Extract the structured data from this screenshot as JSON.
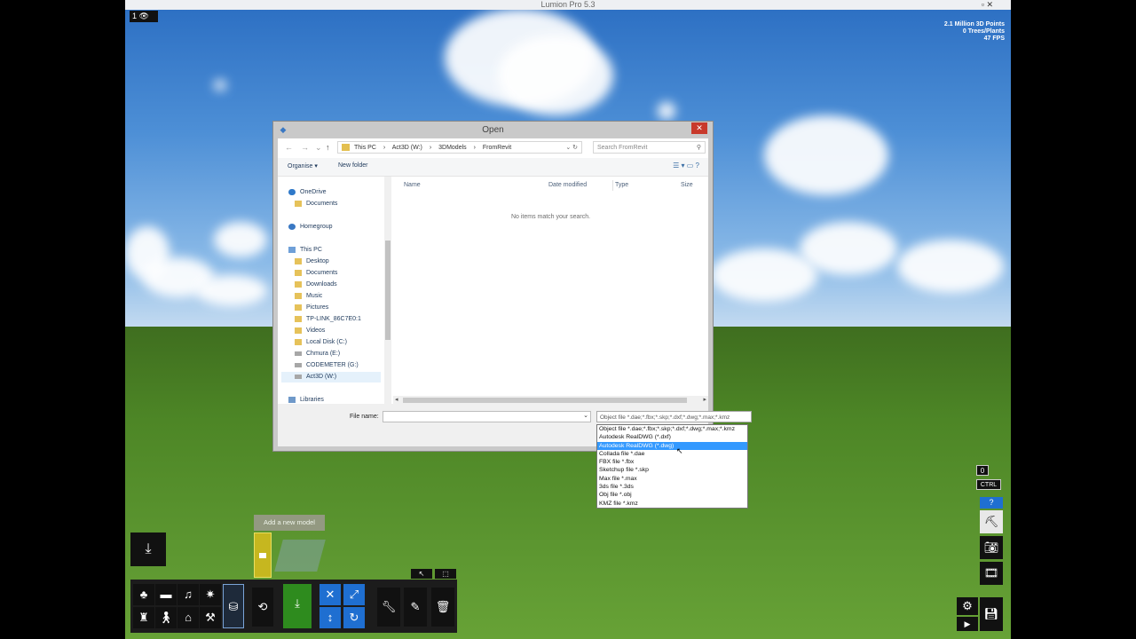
{
  "app": {
    "title": "Lumion Pro 5.3",
    "minimize_glyph": "▫  ✕"
  },
  "viewport": {
    "badge": "1 👁",
    "stats": [
      "2.1 Million 3D Points",
      "0 Trees/Plants",
      "47 FPS"
    ]
  },
  "dialog": {
    "title": "Open",
    "close_glyph": "✕",
    "nav_buttons": [
      "←",
      "→",
      "⌄",
      "↑"
    ],
    "breadcrumbs": [
      "This PC",
      "›",
      "Act3D (W:)",
      "›",
      "3DModels",
      "›",
      "FromRevit"
    ],
    "search_placeholder": "Search FromRevit",
    "commands": {
      "organise": "Organise ▾",
      "new_folder": "New folder"
    },
    "view_icons": "☰ ▾   ▭   ?",
    "nav_items": [
      {
        "label": "OneDrive",
        "icon": "onedrive-icon"
      },
      {
        "label": "Documents",
        "icon": "folder-icon"
      },
      {
        "label": "Homegroup",
        "icon": "homegroup-icon"
      },
      {
        "label": "This PC",
        "icon": "pc-icon"
      },
      {
        "label": "Desktop",
        "icon": "folder-icon"
      },
      {
        "label": "Documents",
        "icon": "folder-icon"
      },
      {
        "label": "Downloads",
        "icon": "folder-icon"
      },
      {
        "label": "Music",
        "icon": "music-icon"
      },
      {
        "label": "Pictures",
        "icon": "folder-icon"
      },
      {
        "label": "TP-LINK_86C7E0:1",
        "icon": "folder-icon"
      },
      {
        "label": "Videos",
        "icon": "folder-icon"
      },
      {
        "label": "Local Disk (C:)",
        "icon": "folder-icon"
      },
      {
        "label": "Chmura (E:)",
        "icon": "drive-icon"
      },
      {
        "label": "CODEMETER (G:)",
        "icon": "drive-icon"
      },
      {
        "label": "Act3D (W:)",
        "icon": "drive-icon"
      },
      {
        "label": "Libraries",
        "icon": "library-icon"
      }
    ],
    "columns": [
      "Name",
      "Date modified",
      "Type",
      "Size"
    ],
    "empty_message": "No items match your search.",
    "file_name_label": "File name:",
    "file_name_value": "",
    "file_type_selected": "Object file *.dae;*.fbx;*.skp;*.dxf;*.dwg;*.max;*.kmz",
    "file_type_options": [
      "Object file *.dae;*.fbx;*.skp;*.dxf;*.dwg;*.max;*.kmz",
      "Autodesk RealDWG (*.dxf)",
      "Autodesk RealDWG (*.dwg)",
      "Collada file *.dae",
      "FBX file *.fbx",
      "Sketchup  file *.skp",
      "Max  file *.max",
      "3ds file *.3ds",
      "Obj file *.obj",
      "KMZ file *.kmz"
    ],
    "highlighted_option_index": 2
  },
  "lumion": {
    "add_model_tooltip": "Add a new model",
    "right_buttons": {
      "zero": "0",
      "ctrl": "CTRL",
      "help": "?"
    },
    "colors": {
      "sky_top": "#2b6ec2",
      "grass": "#4d8626",
      "accent_blue": "#1f6fd1",
      "green_button": "#2e8b1e",
      "dialog_close": "#c8392b",
      "selection": "#3399ff"
    }
  }
}
